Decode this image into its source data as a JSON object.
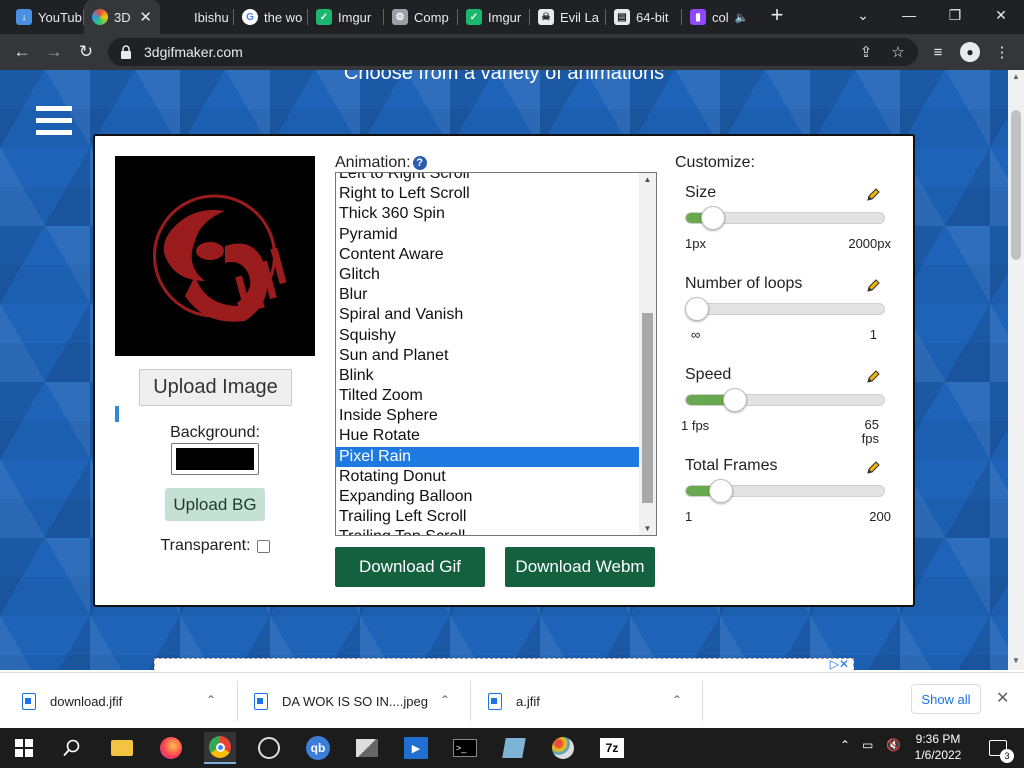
{
  "tabs": [
    {
      "title": "YouTub",
      "icon": "download-icon",
      "color": "#4a90e2"
    },
    {
      "title": "3D",
      "icon": "3dgifmaker-icon",
      "color": "#e6a23c",
      "active": true
    },
    {
      "title": "Ibishu",
      "icon": "blank-icon",
      "color": "#202124"
    },
    {
      "title": "the wo",
      "icon": "google-icon",
      "color": "#ffffff"
    },
    {
      "title": "Imgur",
      "icon": "imgur-icon",
      "color": "#1bb76e"
    },
    {
      "title": "Comp",
      "icon": "comp-icon",
      "color": "#9aa0a6"
    },
    {
      "title": "Imgur",
      "icon": "imgur-icon",
      "color": "#1bb76e"
    },
    {
      "title": "Evil La",
      "icon": "evil-icon",
      "color": "#e8eaed"
    },
    {
      "title": "64-bit",
      "icon": "page-icon",
      "color": "#e8eaed"
    },
    {
      "title": "col",
      "icon": "twitch-icon",
      "color": "#9146ff"
    }
  ],
  "browser": {
    "url": "3dgifmaker.com",
    "new_tab": "+",
    "close": "✕"
  },
  "page": {
    "headline": "Choose from a variety of animations",
    "upload_image": "Upload Image",
    "background_label": "Background:",
    "background_color": "#000000",
    "upload_bg": "Upload BG",
    "transparent_label": "Transparent:",
    "animation_label": "Animation:",
    "help": "?",
    "animations": [
      "Left to Right Scroll",
      "Right to Left Scroll",
      "Thick 360 Spin",
      "Pyramid",
      "Content Aware",
      "Glitch",
      "Blur",
      "Spiral and Vanish",
      "Squishy",
      "Sun and Planet",
      "Blink",
      "Tilted Zoom",
      "Inside Sphere",
      "Hue Rotate",
      "Pixel Rain",
      "Rotating Donut",
      "Expanding Balloon",
      "Trailing Left Scroll",
      "Trailing Top Scroll"
    ],
    "selected_animation": "Pixel Rain",
    "download_gif": "Download Gif",
    "download_webm": "Download Webm",
    "customize_label": "Customize:",
    "sliders": [
      {
        "title": "Size",
        "min": "1px",
        "max": "2000px",
        "fraction": 0.14
      },
      {
        "title": "Number of loops",
        "min": "∞",
        "max": "1",
        "fraction": 0.0
      },
      {
        "title": "Speed",
        "min": "1 fps",
        "max": "65 fps",
        "fraction": 0.25
      },
      {
        "title": "Total Frames",
        "min": "1",
        "max": "200",
        "fraction": 0.18
      }
    ],
    "accent_green": "#14613f",
    "slider_fill": "#6aa84f",
    "selection_blue": "#1e7ae0"
  },
  "downloads": [
    {
      "name": "download.jfif"
    },
    {
      "name": "DA WOK IS SO IN....jpeg"
    },
    {
      "name": "a.jfif"
    }
  ],
  "downloads_show_all": "Show all",
  "taskbar": {
    "time": "9:36 PM",
    "date": "1/6/2022",
    "notifications": "3",
    "apps": [
      "windows-start-icon",
      "search-icon",
      "file-explorer-icon",
      "firefox-icon",
      "chrome-icon",
      "obs-icon",
      "qbittorrent-icon",
      "photos-icon",
      "media-player-icon",
      "terminal-icon",
      "notepad-icon",
      "paint-icon",
      "7zip-icon"
    ],
    "label_7z": "7z",
    "label_qb": "qb"
  }
}
